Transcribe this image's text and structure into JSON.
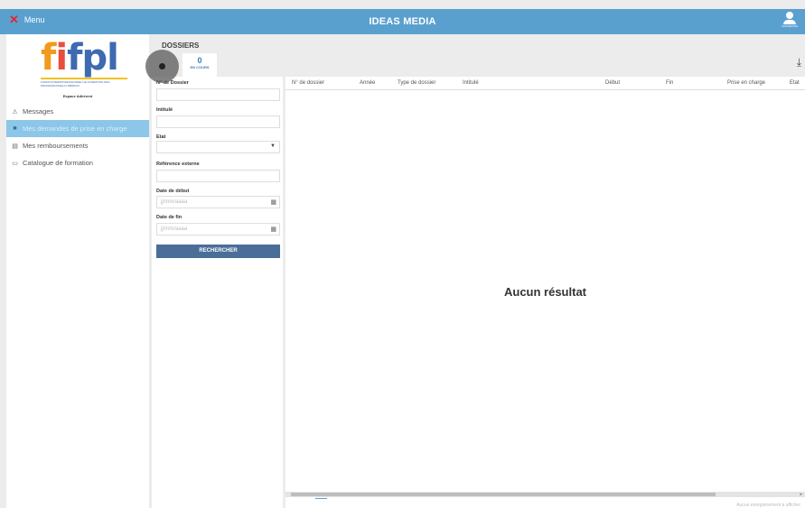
{
  "header": {
    "menu_label": "Menu",
    "title": "IDEAS MEDIA",
    "user_label": "CONNEXION"
  },
  "sidebar": {
    "logo_text": "fifpl",
    "logo_subtitle": "FONDS INTERPROFESSIONNEL DE FORMATION DES PROFESSIONNELS LIBÉRAUX",
    "espace_label": "Espace Adhérent",
    "items": [
      {
        "label": "Messages",
        "icon": "warning-icon",
        "active": false
      },
      {
        "label": "Mes demandes de prise en charge",
        "icon": "folder-icon",
        "active": true
      },
      {
        "label": "Mes remboursements",
        "icon": "money-icon",
        "active": false
      },
      {
        "label": "Catalogue de formation",
        "icon": "catalog-icon",
        "active": false
      }
    ]
  },
  "dossiers": {
    "title": "DOSSIERS",
    "tab_count": "0",
    "tab_label": "EN COURS"
  },
  "filters": {
    "num_label": "N° de Dossier",
    "intitule_label": "Intitulé",
    "etat_label": "Etat",
    "ref_label": "Référence externe",
    "debut_label": "Date de début",
    "debut_placeholder": "jj/mm/aaaa",
    "fin_label": "Date de fin",
    "fin_placeholder": "jj/mm/aaaa",
    "search_label": "RECHERCHER"
  },
  "table": {
    "columns": [
      "N° de dossier",
      "Année",
      "Type de dossier",
      "Intitulé",
      "Début",
      "Fin",
      "Prise en charge",
      "Etat"
    ],
    "empty_message": "Aucun résultat",
    "footer_info": "Aucun enregistrement à afficher"
  },
  "colors": {
    "topbar": "#5aa0cf",
    "active_nav": "#8cc6e8",
    "search_button": "#4b6e99",
    "accent_text": "#3d7db6"
  }
}
